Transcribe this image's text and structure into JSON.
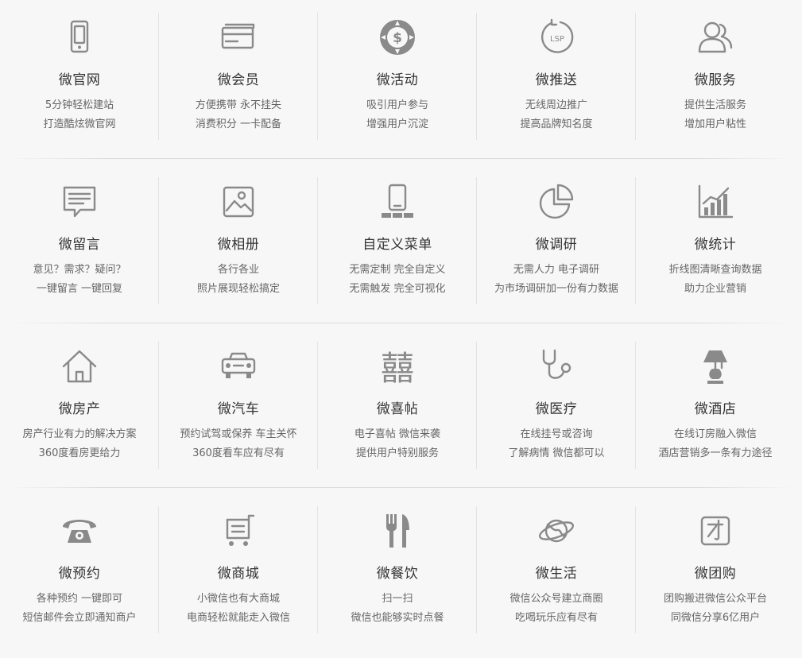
{
  "features": [
    [
      {
        "icon": "phone-icon",
        "title": "微官网",
        "line1": "5分钟轻松建站",
        "line2": "打造酷炫微官网"
      },
      {
        "icon": "card-icon",
        "title": "微会员",
        "line1": "方便携带 永不挂失",
        "line2": "消费积分 一卡配备"
      },
      {
        "icon": "dollar-gear-icon",
        "title": "微活动",
        "line1": "吸引用户参与",
        "line2": "增强用户沉淀"
      },
      {
        "icon": "lsp-icon",
        "title": "微推送",
        "line1": "无线周边推广",
        "line2": "提高品牌知名度"
      },
      {
        "icon": "user-icon",
        "title": "微服务",
        "line1": "提供生活服务",
        "line2": "增加用户粘性"
      }
    ],
    [
      {
        "icon": "message-icon",
        "title": "微留言",
        "line1": "意见？需求？疑问？",
        "line2": "一键留言  一键回复"
      },
      {
        "icon": "picture-icon",
        "title": "微相册",
        "line1": "各行各业",
        "line2": "照片展现轻松搞定"
      },
      {
        "icon": "phone-menu-icon",
        "title": "自定义菜单",
        "line1": "无需定制 完全自定义",
        "line2": "无需触发 完全可视化"
      },
      {
        "icon": "pie-chart-icon",
        "title": "微调研",
        "line1": "无需人力 电子调研",
        "line2": "为市场调研加一份有力数据"
      },
      {
        "icon": "bar-chart-icon",
        "title": "微统计",
        "line1": "折线图清晰查询数据",
        "line2": "助力企业营销"
      }
    ],
    [
      {
        "icon": "house-icon",
        "title": "微房产",
        "line1": "房产行业有力的解决方案",
        "line2": "360度看房更给力"
      },
      {
        "icon": "car-icon",
        "title": "微汽车",
        "line1": "预约试驾或保养 车主关怀",
        "line2": "360度看车应有尽有"
      },
      {
        "icon": "double-happiness-icon",
        "title": "微喜帖",
        "line1": "电子喜帖 微信来袭",
        "line2": "提供用户特别服务"
      },
      {
        "icon": "stethoscope-icon",
        "title": "微医疗",
        "line1": "在线挂号或咨询",
        "line2": "了解病情 微信都可以"
      },
      {
        "icon": "lamp-icon",
        "title": "微酒店",
        "line1": "在线订房融入微信",
        "line2": "酒店营销多一条有力途径"
      }
    ],
    [
      {
        "icon": "telephone-icon",
        "title": "微预约",
        "line1": "各种预约 一键即可",
        "line2": "短信邮件会立即通知商户"
      },
      {
        "icon": "cart-icon",
        "title": "微商城",
        "line1": "小微信也有大商城",
        "line2": "电商轻松就能走入微信"
      },
      {
        "icon": "fork-knife-icon",
        "title": "微餐饮",
        "line1": "扫一扫",
        "line2": "微信也能够实时点餐"
      },
      {
        "icon": "planet-icon",
        "title": "微生活",
        "line1": "微信公众号建立商圈",
        "line2": "吃喝玩乐应有尽有"
      },
      {
        "icon": "group-buy-icon",
        "title": "微团购",
        "line1": "团购搬进微信公众平台",
        "line2": "同微信分享6亿用户"
      }
    ]
  ]
}
